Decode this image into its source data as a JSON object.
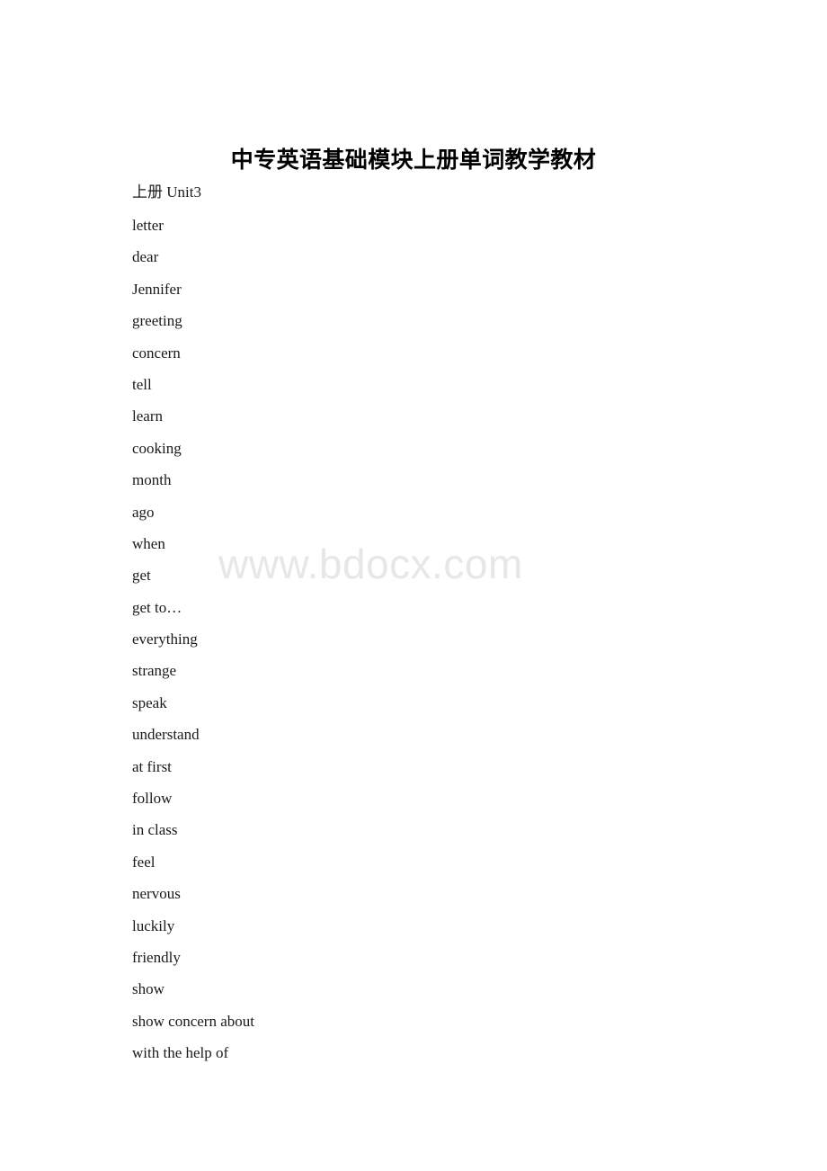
{
  "document": {
    "title": "中专英语基础模块上册单词教学教材",
    "section_label": "上册 Unit3",
    "watermark": "www.bdocx.com",
    "text_color": "#1a1a1a",
    "watermark_color": "#e7e7e7",
    "background_color": "#ffffff",
    "words": [
      "letter",
      "dear",
      "Jennifer",
      "greeting",
      "concern",
      "tell",
      "learn",
      "cooking",
      "month",
      "ago",
      "when",
      "get",
      "get to…",
      "everything",
      "strange",
      "speak",
      "understand",
      "at first",
      "follow",
      "in class",
      "feel",
      "nervous",
      "luckily",
      "friendly",
      "show",
      "show concern about",
      "with the help of"
    ]
  }
}
